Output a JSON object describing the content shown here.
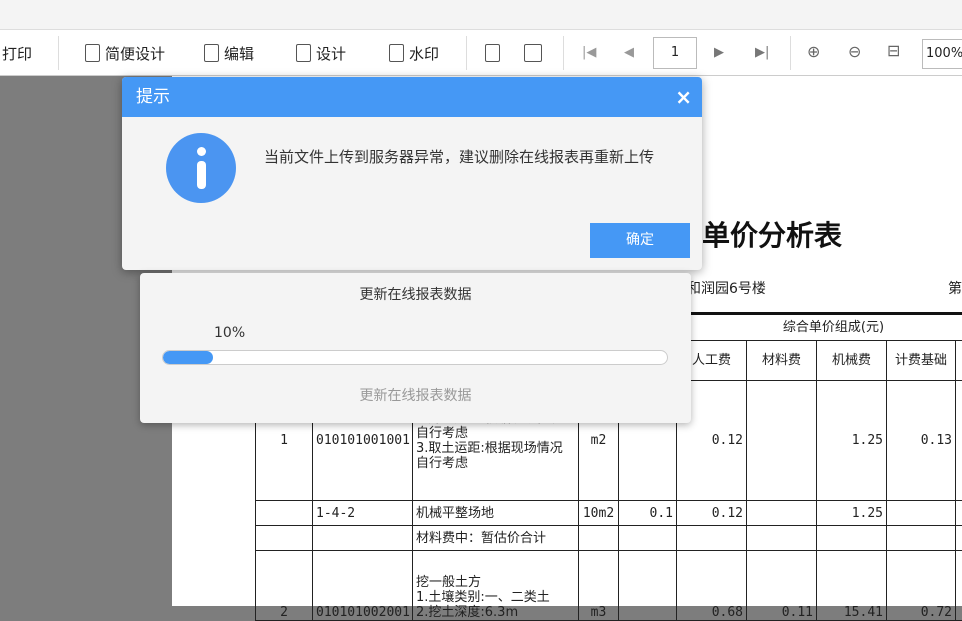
{
  "toolbar": {
    "print": "打印",
    "simple_design": "简便设计",
    "edit": "编辑",
    "design": "设计",
    "watermark": "水印",
    "page": "1",
    "zoom": "100%"
  },
  "report": {
    "title": "单价分析表",
    "project": "和润园6号楼",
    "page_prefix": "第",
    "header_group": "综合单价组成(元)",
    "headers": [
      "人工费",
      "材料费",
      "机械费",
      "计费基础"
    ],
    "rows": [
      {
        "no": "1",
        "code": "010101001001",
        "desc": "2.弃土运距:根据现场情况自行考虑\n3.取土运距:根据现场情况自行考虑",
        "unit": "m2",
        "qty": "",
        "labor": "0.12",
        "material": "",
        "machine": "1.25",
        "base": "0.13"
      },
      {
        "no": "",
        "code": "1-4-2",
        "desc": "机械平整场地",
        "unit": "10m2",
        "qty": "0.1",
        "labor": "0.12",
        "material": "",
        "machine": "1.25",
        "base": ""
      },
      {
        "no": "",
        "code": "",
        "desc": "材料费中：暂估价合计",
        "unit": "",
        "qty": "",
        "labor": "",
        "material": "",
        "machine": "",
        "base": ""
      },
      {
        "no": "2",
        "code": "010101002001",
        "desc": "挖一般土方\n1.土壤类别:一、二类土\n2.挖土深度:6.3m",
        "unit": "m3",
        "qty": "",
        "labor": "0.68",
        "material": "0.11",
        "machine": "15.41",
        "base": "0.72"
      }
    ]
  },
  "dialog": {
    "title": "提示",
    "message": "当前文件上传到服务器异常，建议删除在线报表再重新上传",
    "ok": "确定",
    "close": "×"
  },
  "progress": {
    "title": "更新在线报表数据",
    "percent_label": "10%",
    "percent": 10,
    "status": "更新在线报表数据"
  },
  "colors": {
    "accent": "#4598f5"
  }
}
